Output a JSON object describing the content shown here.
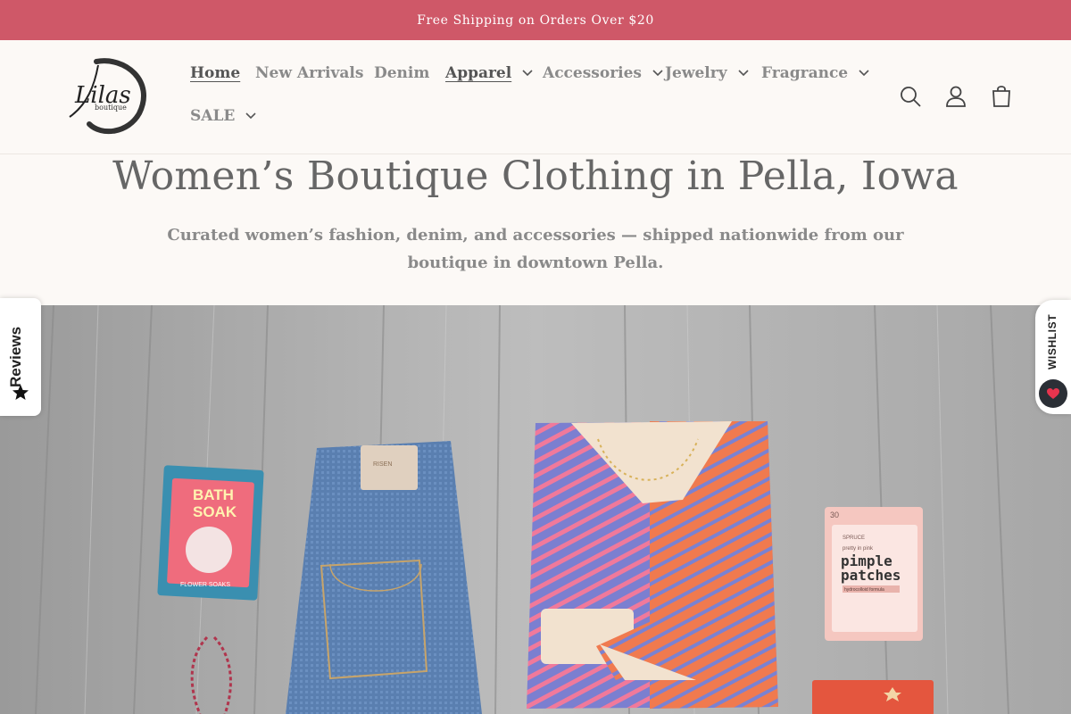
{
  "announcement": {
    "text": "Free Shipping on Orders Over $20"
  },
  "brand": {
    "name": "Lilas",
    "tagline": "boutique"
  },
  "nav": {
    "items": [
      {
        "label": "Home",
        "dropdown": false,
        "active": true
      },
      {
        "label": "New Arrivals",
        "dropdown": false
      },
      {
        "label": "Denim",
        "dropdown": false
      },
      {
        "label": "Apparel",
        "dropdown": true
      },
      {
        "label": "Accessories",
        "dropdown": true
      },
      {
        "label": "Jewelry",
        "dropdown": true
      },
      {
        "label": "Fragrance",
        "dropdown": true
      },
      {
        "label": "SALE",
        "dropdown": true
      }
    ]
  },
  "header_icons": [
    "search-icon",
    "account-icon",
    "cart-icon"
  ],
  "hero": {
    "title": "Women’s Boutique Clothing in Pella, Iowa",
    "subtitle": "Curated women’s fashion, denim, and accessories — shipped nationwide from our boutique in downtown Pella."
  },
  "products": {
    "bath_soak": {
      "line1": "BATH",
      "line2": "SOAK",
      "line3": "FLOWER SOAKS"
    },
    "patches": {
      "count": "30",
      "brand": "SPRUCE",
      "small": "pretty in pink",
      "line1": "pimple",
      "line2": "patches",
      "badge": "hydrocolloid formula"
    },
    "jeans_label": "RISEN"
  },
  "reviews_tab": {
    "label": "Reviews"
  },
  "wishlist_tab": {
    "label": "WISHLIST"
  },
  "colors": {
    "announcement_bg": "#cf5868",
    "page_bg": "#fcf9f6",
    "heart": "#e8344e"
  }
}
